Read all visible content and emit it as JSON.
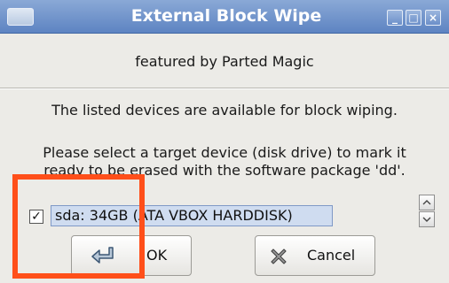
{
  "window": {
    "title": "External Block Wipe",
    "minimize_glyph": "_",
    "maximize_glyph": "□",
    "close_glyph": "×"
  },
  "content": {
    "subtitle": "featured by Parted Magic",
    "line1": "The listed devices are available for block wiping.",
    "line2": "Please select a target device (disk drive) to mark it",
    "line3": "ready to be erased with the software package 'dd'."
  },
  "devices": [
    {
      "label": "sda: 34GB (ATA VBOX HARDDISK)",
      "checked": true
    }
  ],
  "buttons": {
    "ok_label": "OK",
    "cancel_label": "Cancel"
  },
  "colors": {
    "titlebar": "#6f92c9",
    "annotation": "#ff4f1a",
    "selection": "#cfdcf0"
  },
  "icons": {
    "ok": "enter-arrow-icon",
    "cancel": "x-icon",
    "scroll_up": "chevron-up-icon",
    "scroll_down": "chevron-down-icon"
  }
}
